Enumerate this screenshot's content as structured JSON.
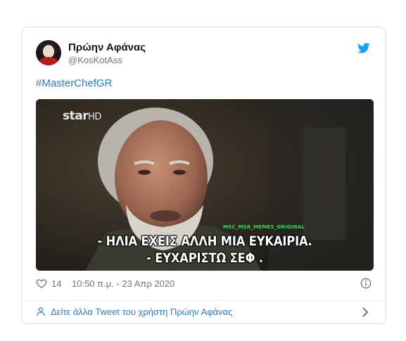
{
  "tweet": {
    "author_name": "Πρώην Αφάνας",
    "author_handle": "@KosKotAss",
    "hashtag": "#MasterChefGR",
    "like_count": "14",
    "timestamp": "10:50 π.μ. - 23 Απρ 2020",
    "more_link": "Δείτε άλλα Tweet του χρήστη Πρώην Αφάνας"
  },
  "media": {
    "channel_logo": "star",
    "channel_logo_suffix": "HD",
    "watermark": "MSC_MSR_MEMES_ORIGINAL",
    "subtitle_line1": "- ΗΛΙΑ ΕΧΕΙΣ ΑΛΛΗ ΜΙΑ ΕΥΚΑΙΡΙΑ.",
    "subtitle_line2": "- ΕΥΧΑΡΙΣΤΩ ΣΕΦ ."
  },
  "icons": {
    "brand": "twitter-bird-icon",
    "like": "heart-icon",
    "info": "info-icon",
    "user": "user-icon",
    "chevron": "chevron-right-icon"
  },
  "colors": {
    "link": "#2b7bb9",
    "muted": "#657786",
    "twitter_blue": "#1da1f2",
    "border": "#d9dee2",
    "watermark": "#29e04a"
  }
}
